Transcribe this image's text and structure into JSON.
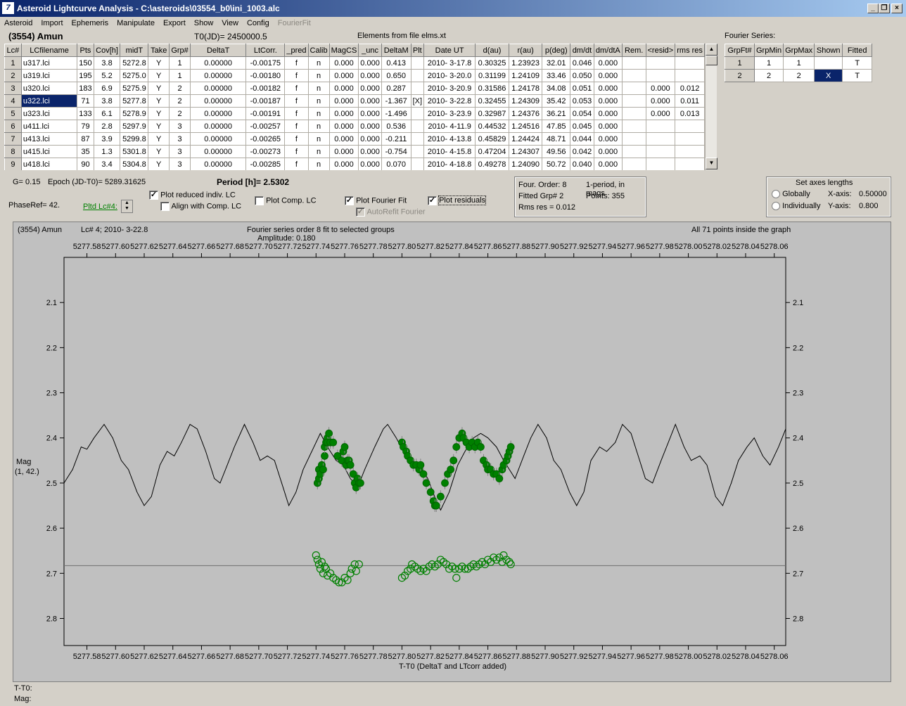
{
  "window": {
    "title": "Asteroid Lightcurve Analysis - C:\\asteroids\\03554_b0\\ini_1003.alc",
    "icon": "app-logo-icon"
  },
  "menu": [
    {
      "label": "Asteroid",
      "enabled": true
    },
    {
      "label": "Import",
      "enabled": true
    },
    {
      "label": "Ephemeris",
      "enabled": true
    },
    {
      "label": "Manipulate",
      "enabled": true
    },
    {
      "label": "Export",
      "enabled": true
    },
    {
      "label": "Show",
      "enabled": true
    },
    {
      "label": "View",
      "enabled": true
    },
    {
      "label": "Config",
      "enabled": true
    },
    {
      "label": "FourierFit",
      "enabled": false
    }
  ],
  "header": {
    "asteroid": "(3554) Amun",
    "t0": "T0(JD)= 2450000.5",
    "elements": "Elements from file elms.xt",
    "fourier_title": "Fourier Series:"
  },
  "lc_table": {
    "columns": [
      "Lc#",
      "LCfilename",
      "Pts",
      "Cov[h]",
      "midT",
      "Take",
      "Grp#",
      "DeltaT",
      "LtCorr.",
      "_pred",
      "Calib",
      "MagCS",
      "_unc",
      "DeltaM",
      "Plt",
      "Date UT",
      "d(au)",
      "r(au)",
      "p(deg)",
      "dm/dt",
      "dm/dtA",
      "Rem.",
      "<resid>",
      "rms res"
    ],
    "rows": [
      [
        "1",
        "u317.lci",
        "150",
        "3.8",
        "5272.8",
        "Y",
        "1",
        "0.00000",
        "-0.00175",
        "f",
        "n",
        "0.000",
        "0.000",
        "0.413",
        "",
        "2010- 3-17.8",
        "0.30325",
        "1.23923",
        "32.01",
        "0.046",
        "0.000",
        "",
        "",
        ""
      ],
      [
        "2",
        "u319.lci",
        "195",
        "5.2",
        "5275.0",
        "Y",
        "1",
        "0.00000",
        "-0.00180",
        "f",
        "n",
        "0.000",
        "0.000",
        "0.650",
        "",
        "2010- 3-20.0",
        "0.31199",
        "1.24109",
        "33.46",
        "0.050",
        "0.000",
        "",
        "",
        ""
      ],
      [
        "3",
        "u320.lci",
        "183",
        "6.9",
        "5275.9",
        "Y",
        "2",
        "0.00000",
        "-0.00182",
        "f",
        "n",
        "0.000",
        "0.000",
        "0.287",
        "",
        "2010- 3-20.9",
        "0.31586",
        "1.24178",
        "34.08",
        "0.051",
        "0.000",
        "",
        "0.000",
        "0.012"
      ],
      [
        "4",
        "u322.lci",
        "71",
        "3.8",
        "5277.8",
        "Y",
        "2",
        "0.00000",
        "-0.00187",
        "f",
        "n",
        "0.000",
        "0.000",
        "-1.367",
        "[X]",
        "2010- 3-22.8",
        "0.32455",
        "1.24309",
        "35.42",
        "0.053",
        "0.000",
        "",
        "0.000",
        "0.011"
      ],
      [
        "5",
        "u323.lci",
        "133",
        "6.1",
        "5278.9",
        "Y",
        "2",
        "0.00000",
        "-0.00191",
        "f",
        "n",
        "0.000",
        "0.000",
        "-1.496",
        "",
        "2010- 3-23.9",
        "0.32987",
        "1.24376",
        "36.21",
        "0.054",
        "0.000",
        "",
        "0.000",
        "0.013"
      ],
      [
        "6",
        "u411.lci",
        "79",
        "2.8",
        "5297.9",
        "Y",
        "3",
        "0.00000",
        "-0.00257",
        "f",
        "n",
        "0.000",
        "0.000",
        "0.536",
        "",
        "2010- 4-11.9",
        "0.44532",
        "1.24516",
        "47.85",
        "0.045",
        "0.000",
        "",
        "",
        ""
      ],
      [
        "7",
        "u413.lci",
        "87",
        "3.9",
        "5299.8",
        "Y",
        "3",
        "0.00000",
        "-0.00265",
        "f",
        "n",
        "0.000",
        "0.000",
        "-0.211",
        "",
        "2010- 4-13.8",
        "0.45829",
        "1.24424",
        "48.71",
        "0.044",
        "0.000",
        "",
        "",
        ""
      ],
      [
        "8",
        "u415.lci",
        "35",
        "1.3",
        "5301.8",
        "Y",
        "3",
        "0.00000",
        "-0.00273",
        "f",
        "n",
        "0.000",
        "0.000",
        "-0.754",
        "",
        "2010- 4-15.8",
        "0.47204",
        "1.24307",
        "49.56",
        "0.042",
        "0.000",
        "",
        "",
        ""
      ],
      [
        "9",
        "u418.lci",
        "90",
        "3.4",
        "5304.8",
        "Y",
        "3",
        "0.00000",
        "-0.00285",
        "f",
        "n",
        "0.000",
        "0.000",
        "0.070",
        "",
        "2010- 4-18.8",
        "0.49278",
        "1.24090",
        "50.72",
        "0.040",
        "0.000",
        "",
        "",
        ""
      ]
    ],
    "selected_row": 3
  },
  "fourier_table": {
    "columns": [
      "GrpFt#",
      "GrpMin",
      "GrpMax",
      "Shown",
      "Fitted"
    ],
    "rows": [
      [
        "1",
        "1",
        "1",
        "",
        "T"
      ],
      [
        "2",
        "2",
        "2",
        "X",
        "T"
      ]
    ]
  },
  "controls": {
    "g": "G= 0.15",
    "epoch": "Epoch (JD-T0)= 5289.31625",
    "period": "Period [h]= 2.5302",
    "phaseref": "PhaseRef= 42.",
    "pltd_lc": "Pltd Lc#4:",
    "plot_reduced": {
      "label": "Plot reduced indiv. LC",
      "checked": true
    },
    "align_comp": {
      "label": "Align with Comp. LC",
      "checked": false
    },
    "plot_comp": {
      "label": "Plot Comp. LC",
      "checked": false
    },
    "plot_fourier": {
      "label": "Plot Fourier Fit",
      "checked": true
    },
    "autorefit": {
      "label": "AutoRefit Fourier",
      "checked": true,
      "enabled": false
    },
    "plot_residuals": {
      "label": "Plot residuals",
      "checked": true
    }
  },
  "fit_info": {
    "order": "Four. Order:  8",
    "mode": "1-period, in mags",
    "grp": "Fitted Grp# 2",
    "points": "Points: 355",
    "rms": "Rms res     = 0.012"
  },
  "axes_box": {
    "title": "Set axes lengths",
    "globally": "Globally",
    "individually": "Individually",
    "xaxis_label": "X-axis:",
    "xaxis_value": "0.50000",
    "yaxis_label": "Y-axis:",
    "yaxis_value": "0.800",
    "selected": "Globally"
  },
  "plot": {
    "top_left": "(3554) Amun",
    "lc_info": "Lc# 4; 2010- 3-22.8",
    "fit_title": "Fourier series order 8 fit to selected groups",
    "amplitude": "Amplitude: 0.180",
    "points_info": "All 71 points inside the graph",
    "y_label_1": "Mag",
    "y_label_2": "(1, 42.)",
    "x_label": "T-T0 (DeltaT and LTcorr added)"
  },
  "status": {
    "t_t0": "T-T0:",
    "mag": "Mag:"
  },
  "chart_data": {
    "type": "scatter",
    "xlabel": "T-T0 (DeltaT and LTcorr added)",
    "ylabel": "Mag",
    "xlim": [
      5277.564,
      5278.068
    ],
    "ylim": [
      2.86,
      2.0
    ],
    "x_ticks": [
      "5277.58",
      "5277.60",
      "5277.62",
      "5277.64",
      "5277.66",
      "5277.68",
      "5277.70",
      "5277.72",
      "5277.74",
      "5277.76",
      "5277.78",
      "5277.80",
      "5277.82",
      "5277.84",
      "5277.86",
      "5277.88",
      "5277.90",
      "5277.92",
      "5277.94",
      "5277.96",
      "5277.98",
      "5278.00",
      "5278.02",
      "5278.04",
      "5278.06"
    ],
    "y_ticks": [
      "2.1",
      "2.2",
      "2.3",
      "2.4",
      "2.5",
      "2.6",
      "2.7",
      "2.8"
    ],
    "residual_baseline": 2.683,
    "fourier_curve": [
      [
        5277.564,
        2.5
      ],
      [
        5277.57,
        2.47
      ],
      [
        5277.576,
        2.42
      ],
      [
        5277.58,
        2.425
      ],
      [
        5277.585,
        2.4
      ],
      [
        5277.592,
        2.37
      ],
      [
        5277.598,
        2.4
      ],
      [
        5277.604,
        2.45
      ],
      [
        5277.609,
        2.47
      ],
      [
        5277.615,
        2.52
      ],
      [
        5277.62,
        2.55
      ],
      [
        5277.625,
        2.53
      ],
      [
        5277.631,
        2.46
      ],
      [
        5277.636,
        2.43
      ],
      [
        5277.641,
        2.44
      ],
      [
        5277.646,
        2.41
      ],
      [
        5277.652,
        2.37
      ],
      [
        5277.657,
        2.38
      ],
      [
        5277.663,
        2.43
      ],
      [
        5277.669,
        2.49
      ],
      [
        5277.673,
        2.5
      ],
      [
        5277.678,
        2.46
      ],
      [
        5277.683,
        2.42
      ],
      [
        5277.69,
        2.37
      ],
      [
        5277.696,
        2.41
      ],
      [
        5277.701,
        2.45
      ],
      [
        5277.706,
        2.44
      ],
      [
        5277.711,
        2.45
      ],
      [
        5277.717,
        2.51
      ],
      [
        5277.721,
        2.55
      ],
      [
        5277.726,
        2.52
      ],
      [
        5277.731,
        2.47
      ],
      [
        5277.737,
        2.43
      ],
      [
        5277.743,
        2.39
      ],
      [
        5277.748,
        2.42
      ],
      [
        5277.754,
        2.45
      ],
      [
        5277.759,
        2.46
      ],
      [
        5277.764,
        2.49
      ],
      [
        5277.769,
        2.51
      ],
      [
        5277.774,
        2.47
      ],
      [
        5277.781,
        2.42
      ],
      [
        5277.787,
        2.38
      ],
      [
        5277.79,
        2.37
      ],
      [
        5277.796,
        2.4
      ],
      [
        5277.801,
        2.43
      ],
      [
        5277.807,
        2.45
      ],
      [
        5277.812,
        2.46
      ],
      [
        5277.818,
        2.49
      ],
      [
        5277.824,
        2.54
      ],
      [
        5277.827,
        2.56
      ],
      [
        5277.833,
        2.52
      ],
      [
        5277.839,
        2.46
      ],
      [
        5277.844,
        2.43
      ],
      [
        5277.85,
        2.4
      ],
      [
        5277.855,
        2.39
      ],
      [
        5277.86,
        2.4
      ],
      [
        5277.866,
        2.42
      ],
      [
        5277.871,
        2.45
      ],
      [
        5277.877,
        2.48
      ],
      [
        5277.879,
        2.49
      ],
      [
        5277.885,
        2.44
      ],
      [
        5277.89,
        2.4
      ],
      [
        5277.895,
        2.37
      ],
      [
        5277.901,
        2.4
      ],
      [
        5277.906,
        2.45
      ],
      [
        5277.911,
        2.47
      ],
      [
        5277.917,
        2.52
      ],
      [
        5277.922,
        2.55
      ],
      [
        5277.927,
        2.52
      ],
      [
        5277.932,
        2.45
      ],
      [
        5277.938,
        2.42
      ],
      [
        5277.943,
        2.43
      ],
      [
        5277.949,
        2.41
      ],
      [
        5277.954,
        2.37
      ],
      [
        5277.96,
        2.39
      ],
      [
        5277.965,
        2.44
      ],
      [
        5277.97,
        2.49
      ],
      [
        5277.975,
        2.5
      ],
      [
        5277.981,
        2.45
      ],
      [
        5277.986,
        2.41
      ],
      [
        5277.991,
        2.37
      ],
      [
        5277.997,
        2.42
      ],
      [
        5278.002,
        2.45
      ],
      [
        5278.008,
        2.44
      ],
      [
        5278.013,
        2.46
      ],
      [
        5278.019,
        2.53
      ],
      [
        5278.024,
        2.55
      ],
      [
        5278.03,
        2.5
      ],
      [
        5278.035,
        2.45
      ],
      [
        5278.041,
        2.42
      ],
      [
        5278.046,
        2.4
      ],
      [
        5278.052,
        2.44
      ],
      [
        5278.057,
        2.46
      ],
      [
        5278.063,
        2.42
      ],
      [
        5278.068,
        2.38
      ]
    ],
    "observations": [
      [
        5277.741,
        2.5
      ],
      [
        5277.742,
        2.49
      ],
      [
        5277.742,
        2.47
      ],
      [
        5277.743,
        2.48
      ],
      [
        5277.744,
        2.46
      ],
      [
        5277.745,
        2.47
      ],
      [
        5277.746,
        2.44
      ],
      [
        5277.746,
        2.42
      ],
      [
        5277.747,
        2.41
      ],
      [
        5277.748,
        2.4
      ],
      [
        5277.748,
        2.41
      ],
      [
        5277.749,
        2.39
      ],
      [
        5277.75,
        2.41
      ],
      [
        5277.752,
        2.41
      ],
      [
        5277.755,
        2.44
      ],
      [
        5277.758,
        2.45
      ],
      [
        5277.759,
        2.43
      ],
      [
        5277.76,
        2.42
      ],
      [
        5277.761,
        2.46
      ],
      [
        5277.762,
        2.45
      ],
      [
        5277.763,
        2.45
      ],
      [
        5277.764,
        2.46
      ],
      [
        5277.766,
        2.48
      ],
      [
        5277.767,
        2.5
      ],
      [
        5277.768,
        2.51
      ],
      [
        5277.769,
        2.49
      ],
      [
        5277.77,
        2.5
      ],
      [
        5277.771,
        2.5
      ],
      [
        5277.8,
        2.41
      ],
      [
        5277.801,
        2.42
      ],
      [
        5277.803,
        2.43
      ],
      [
        5277.804,
        2.44
      ],
      [
        5277.806,
        2.45
      ],
      [
        5277.808,
        2.46
      ],
      [
        5277.81,
        2.46
      ],
      [
        5277.812,
        2.47
      ],
      [
        5277.813,
        2.46
      ],
      [
        5277.815,
        2.48
      ],
      [
        5277.817,
        2.5
      ],
      [
        5277.82,
        2.52
      ],
      [
        5277.822,
        2.54
      ],
      [
        5277.823,
        2.55
      ],
      [
        5277.824,
        2.55
      ],
      [
        5277.827,
        2.53
      ],
      [
        5277.83,
        2.5
      ],
      [
        5277.832,
        2.48
      ],
      [
        5277.834,
        2.47
      ],
      [
        5277.836,
        2.45
      ],
      [
        5277.838,
        2.42
      ],
      [
        5277.84,
        2.4
      ],
      [
        5277.842,
        2.39
      ],
      [
        5277.843,
        2.4
      ],
      [
        5277.845,
        2.41
      ],
      [
        5277.847,
        2.42
      ],
      [
        5277.849,
        2.41
      ],
      [
        5277.851,
        2.42
      ],
      [
        5277.853,
        2.41
      ],
      [
        5277.855,
        2.42
      ],
      [
        5277.857,
        2.45
      ],
      [
        5277.859,
        2.46
      ],
      [
        5277.86,
        2.47
      ],
      [
        5277.862,
        2.47
      ],
      [
        5277.864,
        2.48
      ],
      [
        5277.866,
        2.48
      ],
      [
        5277.868,
        2.49
      ],
      [
        5277.87,
        2.47
      ],
      [
        5277.871,
        2.46
      ],
      [
        5277.873,
        2.45
      ],
      [
        5277.874,
        2.44
      ],
      [
        5277.875,
        2.43
      ],
      [
        5277.876,
        2.42
      ]
    ],
    "residuals": [
      [
        5277.74,
        2.66
      ],
      [
        5277.741,
        2.67
      ],
      [
        5277.742,
        2.68
      ],
      [
        5277.743,
        2.69
      ],
      [
        5277.744,
        2.675
      ],
      [
        5277.745,
        2.7
      ],
      [
        5277.746,
        2.685
      ],
      [
        5277.747,
        2.69
      ],
      [
        5277.748,
        2.705
      ],
      [
        5277.75,
        2.7
      ],
      [
        5277.752,
        2.71
      ],
      [
        5277.754,
        2.715
      ],
      [
        5277.756,
        2.72
      ],
      [
        5277.758,
        2.72
      ],
      [
        5277.76,
        2.71
      ],
      [
        5277.762,
        2.715
      ],
      [
        5277.764,
        2.7
      ],
      [
        5277.765,
        2.69
      ],
      [
        5277.767,
        2.68
      ],
      [
        5277.768,
        2.695
      ],
      [
        5277.77,
        2.68
      ],
      [
        5277.8,
        2.71
      ],
      [
        5277.802,
        2.705
      ],
      [
        5277.804,
        2.695
      ],
      [
        5277.806,
        2.69
      ],
      [
        5277.807,
        2.68
      ],
      [
        5277.809,
        2.685
      ],
      [
        5277.811,
        2.69
      ],
      [
        5277.813,
        2.695
      ],
      [
        5277.815,
        2.69
      ],
      [
        5277.817,
        2.695
      ],
      [
        5277.819,
        2.685
      ],
      [
        5277.821,
        2.68
      ],
      [
        5277.823,
        2.685
      ],
      [
        5277.825,
        2.68
      ],
      [
        5277.827,
        2.67
      ],
      [
        5277.829,
        2.675
      ],
      [
        5277.831,
        2.68
      ],
      [
        5277.833,
        2.69
      ],
      [
        5277.835,
        2.685
      ],
      [
        5277.837,
        2.69
      ],
      [
        5277.838,
        2.71
      ],
      [
        5277.84,
        2.69
      ],
      [
        5277.842,
        2.685
      ],
      [
        5277.844,
        2.69
      ],
      [
        5277.846,
        2.69
      ],
      [
        5277.848,
        2.685
      ],
      [
        5277.85,
        2.68
      ],
      [
        5277.852,
        2.685
      ],
      [
        5277.854,
        2.68
      ],
      [
        5277.856,
        2.675
      ],
      [
        5277.858,
        2.68
      ],
      [
        5277.86,
        2.67
      ],
      [
        5277.862,
        2.675
      ],
      [
        5277.864,
        2.665
      ],
      [
        5277.866,
        2.67
      ],
      [
        5277.868,
        2.665
      ],
      [
        5277.87,
        2.675
      ],
      [
        5277.871,
        2.66
      ],
      [
        5277.873,
        2.67
      ],
      [
        5277.875,
        2.675
      ],
      [
        5277.876,
        2.68
      ]
    ],
    "colors": {
      "curve": "#000000",
      "points": "#008000",
      "residual_line": "#707070",
      "bg": "#c0c0c0"
    }
  }
}
